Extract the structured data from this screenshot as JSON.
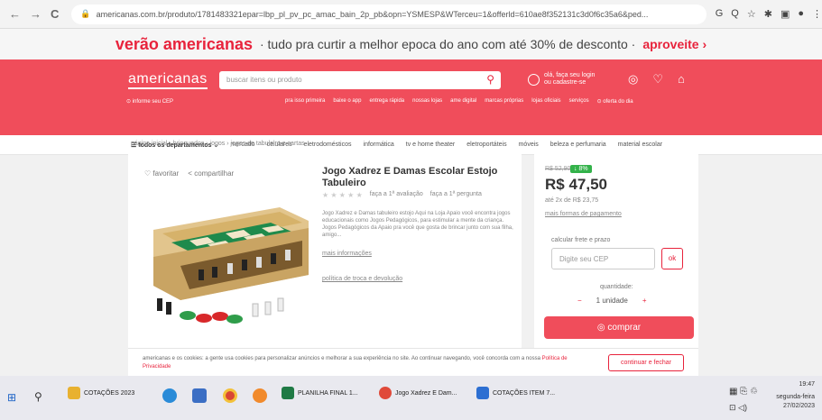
{
  "browser": {
    "url": "americanas.com.br/produto/1781483321epar=lbp_pl_pv_pc_amac_bain_2p_pb&opn=YSMESP&WTerceu=1&offerld=610ae8f352131c3d0f6c35a6&ped...",
    "nav": [
      "←",
      "→",
      "C"
    ],
    "actions": [
      "G",
      "Q",
      "☆",
      "✱",
      "▣",
      "●",
      "⋮"
    ]
  },
  "promo": {
    "brand": "verão americanas",
    "text": "· tudo pra curtir a melhor epoca do ano com até 30% de desconto ·",
    "cta": "aproveite ›"
  },
  "header": {
    "logo": "americanas",
    "search_placeholder": "buscar itens ou produto",
    "login_line1": "olá, faça seu login",
    "login_line2": "ou cadastre-se",
    "subnav": [
      "⊙ informe seu CEP",
      "pra isso primeira",
      "baixe o app",
      "entrega rápida",
      "nossas lojas",
      "ame digital",
      "marcas próprias",
      "lojas oficiais",
      "serviços",
      "⊙ oferta do dia"
    ]
  },
  "departments": {
    "all": "todos os departamentos ⌄",
    "items": [
      "mercado",
      "celulares",
      "eletrodomésticos",
      "informática",
      "tv e home theater",
      "eletroportáteis",
      "móveis",
      "beleza e perfumaria",
      "material escolar"
    ]
  },
  "breadcrumb": "página inicial  ›  brinquedos  ›  jogos  ›  jogos de tabuleiro e cartas",
  "product": {
    "favorite": "♡ favoritar",
    "share": "< compartilhar",
    "title": "Jogo Xadrez E Damas Escolar Estojo Tabuleiro",
    "stars": "★ ★ ★ ★ ★",
    "rate_link": "faça a 1ª avaliação",
    "question_link": "faça a 1ª pergunta",
    "description": "Jogo Xadrez e Damas tabuleiro estojo Aqui na Loja Apaio você encontra jogos educacionais como Jogos Pedagógicos, para estimular a mente da criança. Jogos Pedagógicos da Apaio pra você que gosta de brincar junto com sua filha, amigo...",
    "more_info": "mais informações",
    "policy": "política de troca e devolução"
  },
  "pricing": {
    "old_price": "R$ 52,90",
    "discount": "↓ 8%",
    "price": "R$ 47,50",
    "installments": "até 2x de R$ 23,75",
    "payment_options": "mais formas de pagamento",
    "shipping_label": "calcular frete e prazo",
    "cep_placeholder": "Digite seu CEP",
    "ok_label": "ok",
    "qty_label": "quantidade:",
    "qty_value": "1 unidade",
    "minus": "−",
    "plus": "+",
    "buy": "◎ comprar"
  },
  "cookie": {
    "text": "americanas e os cookies: a gente usa cookies para personalizar anúncios e melhorar a sua experiência no site. Ao continuar navegando, você concorda com a nossa",
    "link": "Política de Privacidade",
    "button": "continuar e fechar"
  },
  "taskbar": {
    "items": [
      {
        "label": "COTAÇÕES 2023",
        "color": "#e8b130"
      },
      {
        "label": "PLANILHA FINAL 1...",
        "color": "#1f7a45"
      },
      {
        "label": "Jogo Xadrez E Dam...",
        "color": "#e04a3a"
      },
      {
        "label": "COTAÇÕES ITEM 7...",
        "color": "#2d6fd2"
      }
    ],
    "time": "19:47",
    "day": "segunda-feira",
    "date": "27/02/2023"
  }
}
